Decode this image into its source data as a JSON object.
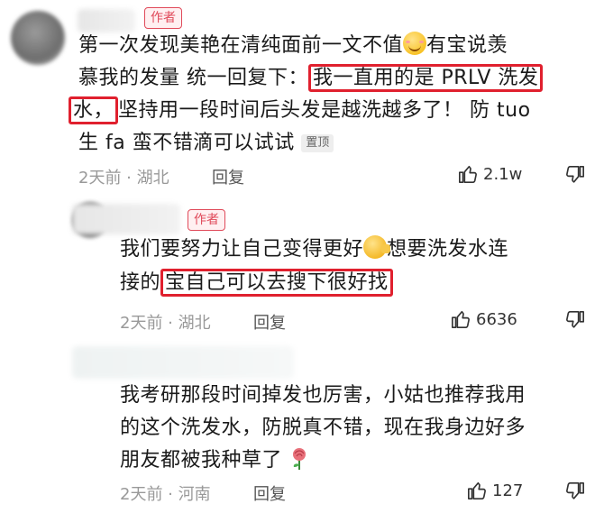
{
  "comments": [
    {
      "author_badge": "作者",
      "line1_a": "第一次发现美艳在清纯面前一文不值",
      "line1_b": "有宝说羡",
      "line2_a": "慕我的发量 统一回复下：",
      "line2_hl": "我一直用的是 PRLV 洗发",
      "line3_hl": "水，",
      "line3_b": "坚持用一段时间后头发是越洗越多了！ 防 tuo",
      "line4": "生 fa 蛮不错滴可以试试",
      "pinned_label": "置顶",
      "time_location": "2天前 · 湖北",
      "reply_label": "回复",
      "likes": "2.1w"
    },
    {
      "author_badge": "作者",
      "line1_a": "我们要努力让自己变得更好",
      "line1_b": "想要洗发水连",
      "line2_a": "接的",
      "line2_hl": "宝自己可以去搜下很好找",
      "time_location": "2天前 · 湖北",
      "reply_label": "回复",
      "likes": "6636"
    },
    {
      "line1": "我考研那段时间掉发也厉害，小姑也推荐我用",
      "line2": "的这个洗发水，防脱真不错，现在我身边好多",
      "line3": "朋友都被我种草了",
      "time_location": "2天前 · 河南",
      "reply_label": "回复",
      "likes": "127"
    }
  ],
  "icons": {
    "like": "thumbs-up-icon",
    "dislike": "thumbs-down-icon",
    "emoji_smile": "blushing-smile-emoji",
    "emoji_fight": "fighting-emoji",
    "emoji_rose": "rose-emoji"
  },
  "colors": {
    "highlight_box": "#e0202e",
    "author_badge": "#e04a5a",
    "meta_text": "#999999"
  }
}
